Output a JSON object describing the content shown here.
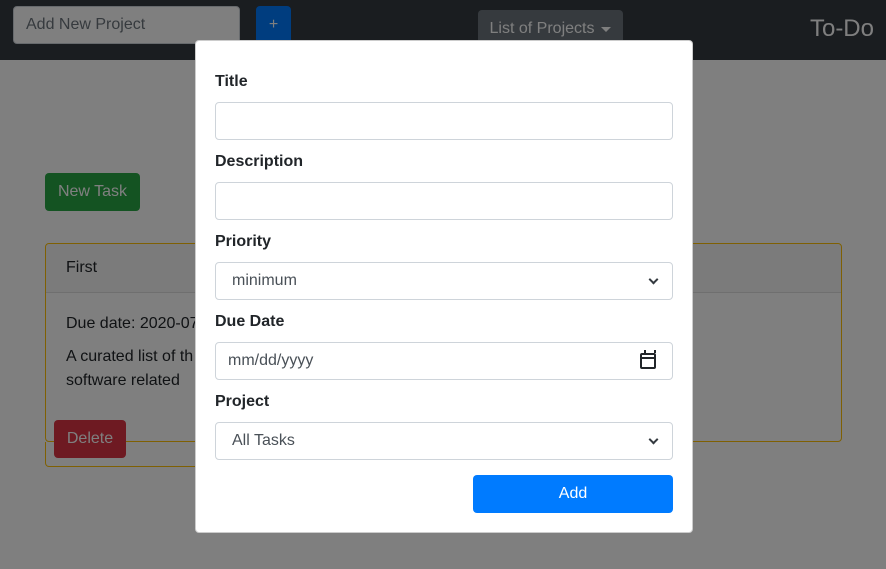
{
  "navbar": {
    "project_input_placeholder": "Add New Project",
    "add_project_label": "+",
    "projects_dropdown_label": "List of Projects",
    "brand": "To-Do"
  },
  "main": {
    "new_task_label": "New Task",
    "task": {
      "title": "First",
      "due_text": "Due date: 2020-07",
      "description": "A curated list of th software related",
      "delete_label": "Delete"
    }
  },
  "modal": {
    "title_label": "Title",
    "title_value": "",
    "description_label": "Description",
    "description_value": "",
    "priority_label": "Priority",
    "priority_selected": "minimum",
    "due_date_label": "Due Date",
    "due_date_placeholder": "mm/dd/yyyy",
    "project_label": "Project",
    "project_selected": "All Tasks",
    "add_label": "Add"
  },
  "colors": {
    "navbar": "#343a40",
    "primary": "#007bff",
    "success": "#28a745",
    "danger": "#dc3545",
    "warning_border": "#ffc107",
    "secondary": "#6c757d"
  },
  "icons": [
    "caret-down-icon",
    "chevron-down-icon",
    "calendar-icon"
  ]
}
